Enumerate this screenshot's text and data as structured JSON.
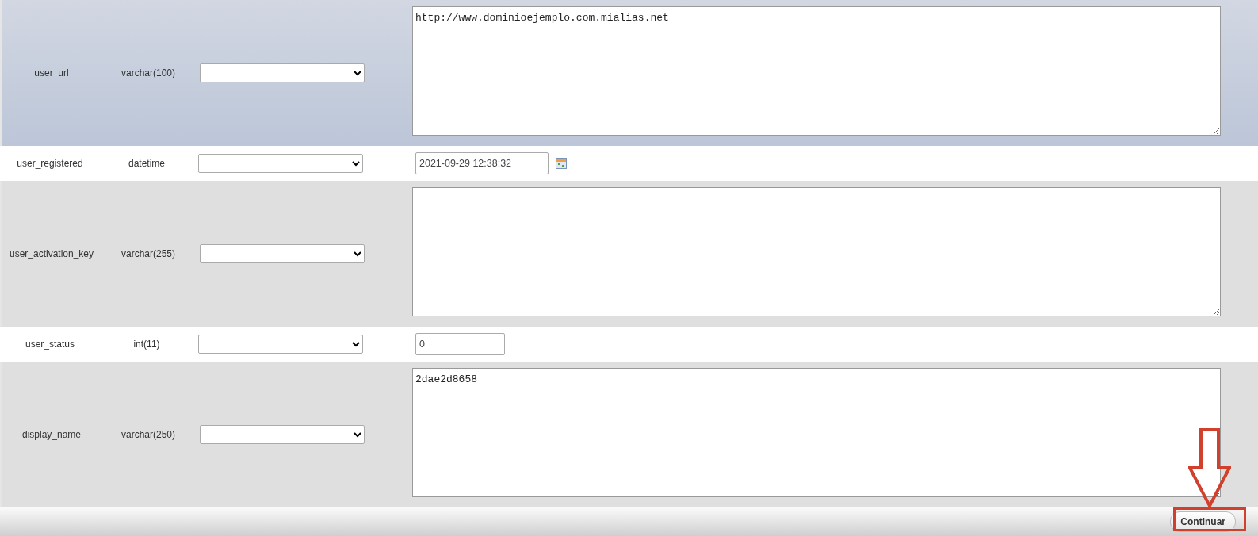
{
  "rows": [
    {
      "name": "user_url",
      "type": "varchar(100)",
      "highlighted": true,
      "kind": "textarea",
      "value": "http://www.dominioejemplo.com.mialias.net"
    },
    {
      "name": "user_registered",
      "type": "datetime",
      "highlighted": false,
      "kind": "datetime",
      "value": "2021-09-29 12:38:32"
    },
    {
      "name": "user_activation_key",
      "type": "varchar(255)",
      "highlighted": false,
      "kind": "textarea"
    },
    {
      "name": "user_status",
      "type": "int(11)",
      "highlighted": false,
      "kind": "input",
      "value": "0"
    },
    {
      "name": "display_name",
      "type": "varchar(250)",
      "highlighted": false,
      "kind": "textarea",
      "value": "2dae2d8658"
    }
  ],
  "footer": {
    "button": "Continuar",
    "annotation": true
  }
}
